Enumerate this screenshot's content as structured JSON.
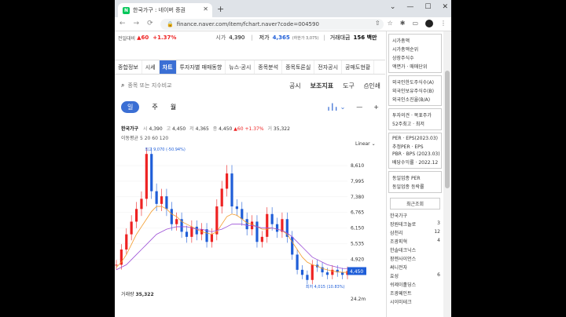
{
  "browser": {
    "tab_title": "한국가구 : 네이버 증권",
    "favicon": "N",
    "url": "finance.naver.com/item/fchart.naver?code=004590"
  },
  "stock_strip": {
    "prev_label": "전일대비",
    "change": "▲60",
    "change_pct": "+1.37%",
    "open_label": "시가",
    "open": "4,390",
    "low_label": "저가",
    "low": "4,365",
    "low_limit": "(하한가 3,075)",
    "amount_label": "거래대금",
    "amount": "156 백만"
  },
  "menu": [
    "종합정보",
    "시세",
    "차트",
    "투자자별 매매동향",
    "뉴스·공시",
    "종목분석",
    "종목토론실",
    "전자공시",
    "공매도현황"
  ],
  "menu_active": 2,
  "search": {
    "placeholder": "종목 또는 지수비교",
    "right": [
      "공시",
      "보조지표",
      "도구",
      "인쇄"
    ]
  },
  "periods": [
    "일",
    "주",
    "월"
  ],
  "ohlc": {
    "name": "한국가구",
    "open_l": "시",
    "open": "4,390",
    "high_l": "고",
    "high": "4,450",
    "low_l": "저",
    "low": "4,365",
    "close_l": "종",
    "close": "4,450",
    "chg": "▲60",
    "pct": "+1.37%",
    "vol_l": "거",
    "vol": "35,322"
  },
  "ma_legend": "이동평균 5 20 60 120",
  "scale_type": "Linear",
  "annotations": {
    "high": "최고 9,070 (-50.94%)",
    "low": "최저 4,015 (10.83%)"
  },
  "volume": {
    "label": "거래량",
    "value": "35,322",
    "axis": "24.2m"
  },
  "chart_data": {
    "type": "line",
    "y_ticks": [
      "8,610",
      "7,995",
      "7,380",
      "6,765",
      "6,150",
      "5,535",
      "4,920"
    ],
    "last_price": "4,450",
    "ylim": [
      4000,
      9200
    ],
    "close": [
      4700,
      5300,
      5900,
      6400,
      6900,
      7300,
      9070,
      7600,
      7100,
      7400,
      6900,
      6300,
      6500,
      6000,
      5800,
      6200,
      5900,
      6100,
      5600,
      5900,
      7000,
      7700,
      8300,
      7000,
      6900,
      6500,
      6100,
      6400,
      5600,
      5800,
      6700,
      6300,
      6000,
      6500,
      5800,
      5100,
      4500,
      4300,
      4100,
      4700,
      4600,
      4400,
      4300,
      4500,
      4400,
      4300,
      4450
    ],
    "ma20": [
      4600,
      4800,
      5100,
      5500,
      5900,
      6200,
      6500,
      6800,
      7000,
      7000,
      6900,
      6700,
      6600,
      6400,
      6300,
      6200,
      6100,
      6000,
      5950,
      5900,
      6000,
      6300,
      6600,
      6700,
      6650,
      6500,
      6350,
      6300,
      6200,
      6100,
      6100,
      6150,
      6100,
      6050,
      5900,
      5600,
      5300,
      5000,
      4800,
      4700,
      4650,
      4550,
      4500,
      4450,
      4420,
      4400,
      4400
    ],
    "ma60": [
      4500,
      4600,
      4700,
      4900,
      5100,
      5300,
      5500,
      5700,
      5900,
      6000,
      6100,
      6150,
      6200,
      6200,
      6200,
      6150,
      6100,
      6100,
      6050,
      6000,
      6050,
      6100,
      6200,
      6300,
      6300,
      6300,
      6250,
      6250,
      6200,
      6150,
      6150,
      6150,
      6100,
      6050,
      5950,
      5800,
      5600,
      5400,
      5200,
      5000,
      4900,
      4800,
      4700,
      4650,
      4600,
      4550,
      4550
    ]
  },
  "side": {
    "top": [
      "시가총액",
      "시가총액순위",
      "상장주식수",
      "액면가 · 매매단위"
    ],
    "foreign": [
      "외국인한도주식수(A)",
      "외국인보유주식수(B)",
      "외국인소진율(B/A)"
    ],
    "opinion": [
      "투자의견 · 목표주가",
      "52주최고 · 최저"
    ],
    "per": [
      "PER · EPS(2023.03)",
      "추정PER · EPS",
      "PBR · BPS (2023.03)",
      "배당수익률 · 2022.12"
    ],
    "industry": [
      "동일업종 PER",
      "동일업종 등락률"
    ],
    "recent_title": "최근조회",
    "recent": [
      {
        "name": "한국가구",
        "v": ""
      },
      {
        "name": "장원테크놀로",
        "v": "3"
      },
      {
        "name": "삼천리",
        "v": "12"
      },
      {
        "name": "조광피혁",
        "v": "4"
      },
      {
        "name": "한솔테크닉스",
        "v": ""
      },
      {
        "name": "팜젠사이언스",
        "v": ""
      },
      {
        "name": "써니전자",
        "v": ""
      },
      {
        "name": "효성",
        "v": "6"
      },
      {
        "name": "쉬제이홀딩스",
        "v": ""
      },
      {
        "name": "조광페인트",
        "v": ""
      },
      {
        "name": "시이미테크",
        "v": ""
      }
    ]
  }
}
